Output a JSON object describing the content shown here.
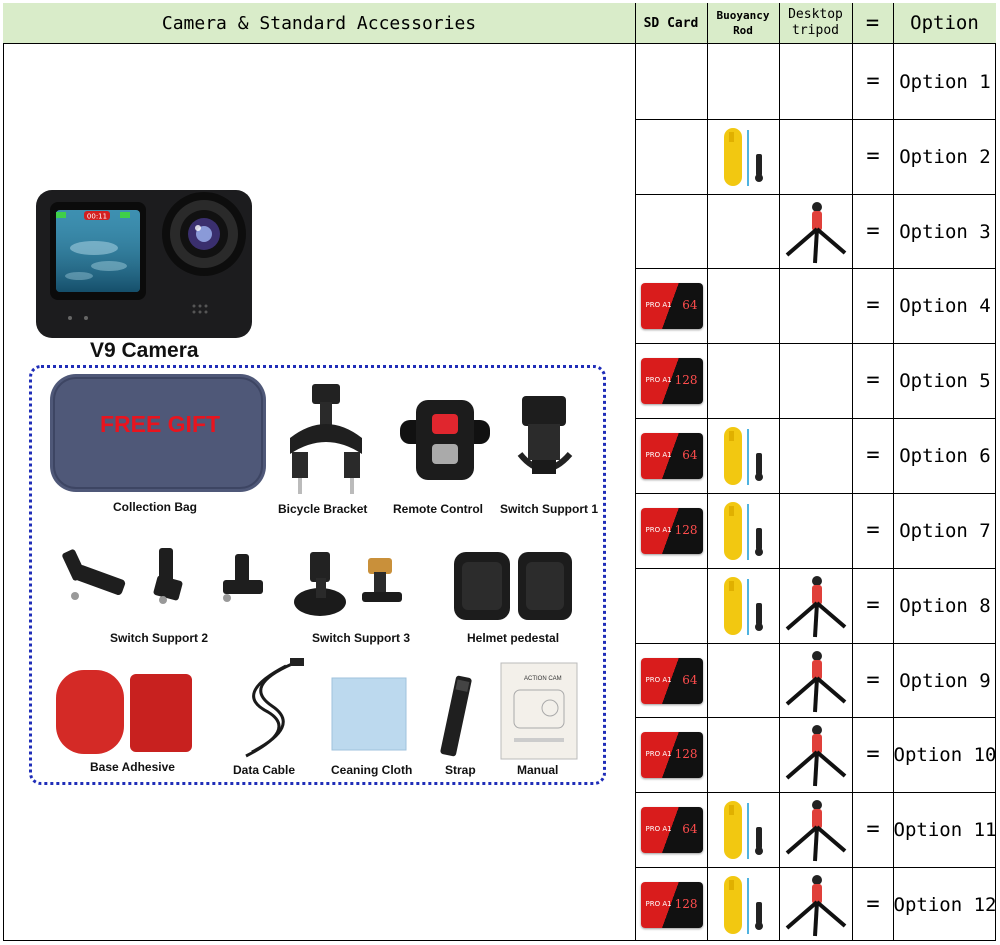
{
  "header": {
    "camera_accessories": "Camera & Standard Accessories",
    "sd_card": "SD Card",
    "buoyancy_rod": "Buoyancy Rod",
    "desktop_tripod": "Desktop tripod",
    "equals": "=",
    "option": "Option"
  },
  "camera": {
    "label": "V9 Camera",
    "screen_time": "00:11"
  },
  "accessories": {
    "bag_print": "FREE GIFT",
    "collection_bag": "Collection Bag",
    "bicycle_bracket": "Bicycle Bracket",
    "remote_control": "Remote Control",
    "switch_support_1": "Switch Support 1",
    "switch_support_2": "Switch Support 2",
    "switch_support_3": "Switch Support 3",
    "helmet_pedestal": "Helmet pedestal",
    "base_adhesive": "Base Adhesive",
    "data_cable": "Data Cable",
    "cleaning_cloth": "Ceaning Cloth",
    "strap": "Strap",
    "manual": "Manual",
    "manual_cover": "ACTION CAM"
  },
  "rows": [
    {
      "sd": "",
      "rod": false,
      "tripod": false,
      "eq": "=",
      "option": "Option 1"
    },
    {
      "sd": "",
      "rod": true,
      "tripod": false,
      "eq": "=",
      "option": "Option 2"
    },
    {
      "sd": "",
      "rod": false,
      "tripod": true,
      "eq": "=",
      "option": "Option 3"
    },
    {
      "sd": "64",
      "rod": false,
      "tripod": false,
      "eq": "=",
      "option": "Option 4"
    },
    {
      "sd": "128",
      "rod": false,
      "tripod": false,
      "eq": "=",
      "option": "Option 5"
    },
    {
      "sd": "64",
      "rod": true,
      "tripod": false,
      "eq": "=",
      "option": "Option 6"
    },
    {
      "sd": "128",
      "rod": true,
      "tripod": false,
      "eq": "=",
      "option": "Option 7"
    },
    {
      "sd": "",
      "rod": true,
      "tripod": true,
      "eq": "=",
      "option": "Option 8"
    },
    {
      "sd": "64",
      "rod": false,
      "tripod": true,
      "eq": "=",
      "option": "Option 9"
    },
    {
      "sd": "128",
      "rod": false,
      "tripod": true,
      "eq": "=",
      "option": "Option 10"
    },
    {
      "sd": "64",
      "rod": true,
      "tripod": true,
      "eq": "=",
      "option": "Option 11"
    },
    {
      "sd": "128",
      "rod": true,
      "tripod": true,
      "eq": "=",
      "option": "Option 12"
    }
  ],
  "sd_card_print": "PRO A1",
  "colors": {
    "header_bg": "#d9ecc9",
    "border": "#000000",
    "dotted_frame": "#1f2db8",
    "gift_text": "#e8141e",
    "sd_red": "#d91c1c",
    "rod_yellow": "#f2c811",
    "tripod_red": "#e0403a"
  }
}
